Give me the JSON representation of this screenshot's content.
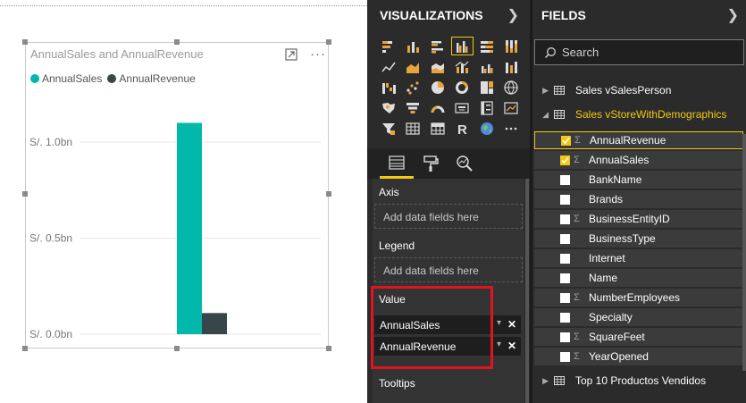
{
  "visual": {
    "title": "AnnualSales and AnnualRevenue",
    "legend": [
      {
        "label": "AnnualSales",
        "color": "#01b8aa"
      },
      {
        "label": "AnnualRevenue",
        "color": "#374649"
      }
    ]
  },
  "chart_data": {
    "type": "bar",
    "title": "AnnualSales and AnnualRevenue",
    "categories": [
      ""
    ],
    "series": [
      {
        "name": "AnnualSales",
        "values": [
          1.1
        ],
        "color": "#01b8aa"
      },
      {
        "name": "AnnualRevenue",
        "values": [
          0.11
        ],
        "color": "#374649"
      }
    ],
    "yticks": [
      {
        "value": 0.0,
        "label": "S/. 0.0bn"
      },
      {
        "value": 0.5,
        "label": "S/. 0.5bn"
      },
      {
        "value": 1.0,
        "label": "S/. 1.0bn"
      }
    ],
    "ylim": [
      0,
      1.2
    ],
    "grid": true,
    "legend_position": "top-left",
    "xlabel": "",
    "ylabel": ""
  },
  "viz_pane": {
    "title": "VISUALIZATIONS",
    "wells": {
      "axis_label": "Axis",
      "axis_placeholder": "Add data fields here",
      "legend_label": "Legend",
      "legend_placeholder": "Add data fields here",
      "value_label": "Value",
      "values": [
        "AnnualSales",
        "AnnualRevenue"
      ],
      "tooltips_label": "Tooltips"
    }
  },
  "fields_pane": {
    "title": "FIELDS",
    "search_placeholder": "Search",
    "tables": [
      {
        "name": "Sales vSalesPerson",
        "expanded": false
      },
      {
        "name": "Sales vStoreWithDemographics",
        "expanded": true
      },
      {
        "name": "Top 10 Productos Vendidos",
        "expanded": false
      }
    ],
    "fields": [
      {
        "name": "AnnualRevenue",
        "checked": true,
        "sigma": true
      },
      {
        "name": "AnnualSales",
        "checked": true,
        "sigma": true
      },
      {
        "name": "BankName",
        "checked": false,
        "sigma": false
      },
      {
        "name": "Brands",
        "checked": false,
        "sigma": false
      },
      {
        "name": "BusinessEntityID",
        "checked": false,
        "sigma": true
      },
      {
        "name": "BusinessType",
        "checked": false,
        "sigma": false
      },
      {
        "name": "Internet",
        "checked": false,
        "sigma": false
      },
      {
        "name": "Name",
        "checked": false,
        "sigma": false
      },
      {
        "name": "NumberEmployees",
        "checked": false,
        "sigma": true
      },
      {
        "name": "Specialty",
        "checked": false,
        "sigma": false
      },
      {
        "name": "SquareFeet",
        "checked": false,
        "sigma": true
      },
      {
        "name": "YearOpened",
        "checked": false,
        "sigma": true
      }
    ]
  }
}
